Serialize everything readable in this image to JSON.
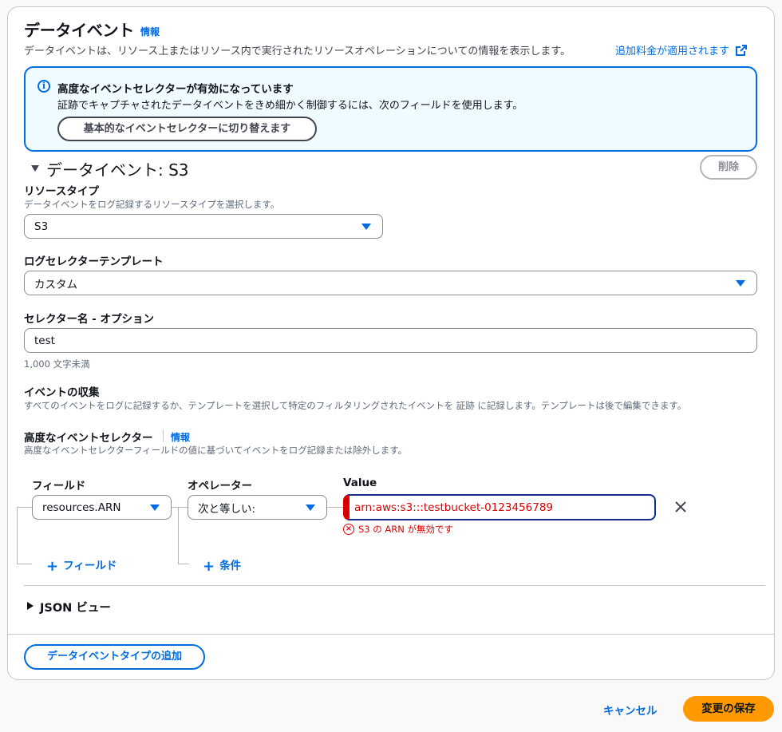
{
  "header": {
    "title": "データイベント",
    "info_link": "情報",
    "description": "データイベントは、リソース上またはリソース内で実行されたリソースオペレーションについての情報を表示します。",
    "pricing_link": "追加料金が適用されます"
  },
  "alert": {
    "title": "高度なイベントセレクターが有効になっています",
    "text": "証跡でキャプチャされたデータイベントをきめ細かく制御するには、次のフィールドを使用します。",
    "switch_button": "基本的なイベントセレクターに切り替えます"
  },
  "data_event": {
    "section_title": "データイベント: S3",
    "delete_button": "削除",
    "resource_type": {
      "label": "リソースタイプ",
      "description": "データイベントをログ記録するリソースタイプを選択します。",
      "value": "S3"
    },
    "log_selector_template": {
      "label": "ログセレクターテンプレート",
      "value": "カスタム"
    },
    "selector_name": {
      "label": "セレクター名 - オプション",
      "value": "test",
      "hint": "1,000 文字未満"
    },
    "event_collection": {
      "label": "イベントの収集",
      "description": "すべてのイベントをログに記録するか、テンプレートを選択して特定のフィルタリングされたイベントを 証跡 に記録します。テンプレートは後で編集できます。"
    },
    "advanced_selectors": {
      "label": "高度なイベントセレクター",
      "info_link": "情報",
      "description": "高度なイベントセレクターフィールドの値に基づいてイベントをログ記録または除外します。",
      "columns": {
        "field": "フィールド",
        "operator": "オペレーター",
        "value": "Value"
      },
      "row": {
        "field": "resources.ARN",
        "operator": "次と等しい:",
        "value": "arn:aws:s3:::testbucket-0123456789",
        "error": "S3 の ARN が無効です"
      },
      "add_field": "フィールド",
      "add_condition": "条件"
    },
    "json_view": "JSON ビュー"
  },
  "add_type_button": "データイベントタイプの追加",
  "footer": {
    "cancel": "キャンセル",
    "save": "変更の保存"
  },
  "colors": {
    "accent": "#006ce0",
    "error": "#db0000",
    "primary_button": "#ff9900"
  }
}
